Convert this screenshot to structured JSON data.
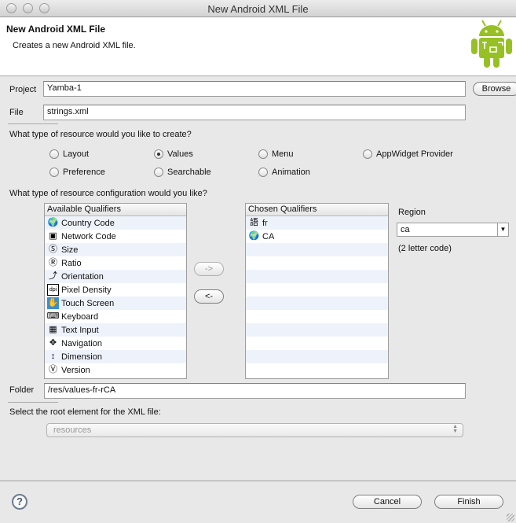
{
  "window": {
    "title": "New Android XML File"
  },
  "header": {
    "title": "New Android XML File",
    "subtitle": "Creates a new Android XML file.",
    "logo_icon": "android-robot-icon"
  },
  "project": {
    "label": "Project",
    "value": "Yamba-1",
    "browse_label": "Browse"
  },
  "file": {
    "label": "File",
    "value": "strings.xml"
  },
  "resource_type": {
    "question": "What type of resource would you like to create?",
    "options": [
      {
        "label": "Layout",
        "selected": false
      },
      {
        "label": "Values",
        "selected": true
      },
      {
        "label": "Menu",
        "selected": false
      },
      {
        "label": "AppWidget Provider",
        "selected": false
      },
      {
        "label": "Preference",
        "selected": false
      },
      {
        "label": "Searchable",
        "selected": false
      },
      {
        "label": "Animation",
        "selected": false
      }
    ]
  },
  "configuration": {
    "question": "What type of resource configuration would you like?",
    "available": {
      "header": "Available Qualifiers",
      "items": [
        {
          "label": "Country Code",
          "icon": "country-code-icon"
        },
        {
          "label": "Network Code",
          "icon": "network-code-icon"
        },
        {
          "label": "Size",
          "icon": "size-icon"
        },
        {
          "label": "Ratio",
          "icon": "ratio-icon"
        },
        {
          "label": "Orientation",
          "icon": "orientation-icon"
        },
        {
          "label": "Pixel Density",
          "icon": "dpi-icon"
        },
        {
          "label": "Touch Screen",
          "icon": "touch-screen-icon"
        },
        {
          "label": "Keyboard",
          "icon": "keyboard-icon"
        },
        {
          "label": "Text Input",
          "icon": "text-input-icon"
        },
        {
          "label": "Navigation",
          "icon": "navigation-icon"
        },
        {
          "label": "Dimension",
          "icon": "dimension-icon"
        },
        {
          "label": "Version",
          "icon": "version-icon"
        }
      ]
    },
    "add_button": "->",
    "remove_button": "<-",
    "chosen": {
      "header": "Chosen Qualifiers",
      "items": [
        {
          "label": "fr",
          "icon": "language-icon"
        },
        {
          "label": "CA",
          "icon": "region-icon"
        }
      ]
    },
    "region": {
      "label": "Region",
      "value": "ca",
      "hint": "(2 letter code)"
    }
  },
  "folder": {
    "label": "Folder",
    "value": "/res/values-fr-rCA"
  },
  "root_element": {
    "question": "Select the root element for the XML file:",
    "value": "resources"
  },
  "footer": {
    "cancel_label": "Cancel",
    "finish_label": "Finish",
    "help_glyph": "?"
  }
}
